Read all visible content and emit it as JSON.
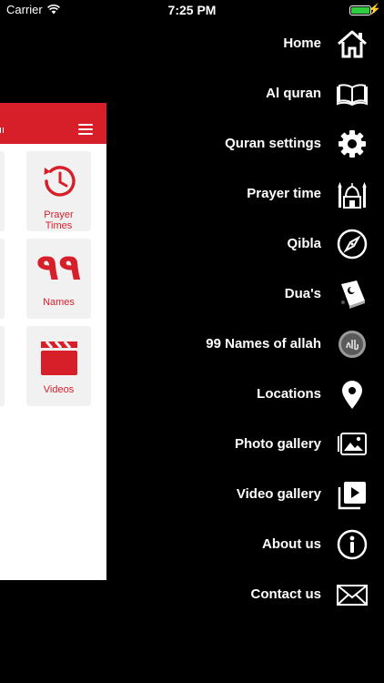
{
  "status_bar": {
    "carrier": "Carrier",
    "time": "7:25 PM",
    "battery_percent": 100,
    "charging": "⚡"
  },
  "panel": {
    "accent": "#d71f2a",
    "tiles": [
      {
        "label": "Prayer\nTimes",
        "icon": "clock-history-icon"
      },
      {
        "label": "Names",
        "icon": "arabic-99-icon",
        "glyph": "٩٩"
      },
      {
        "label": "Videos",
        "icon": "clapperboard-icon"
      }
    ]
  },
  "menu": {
    "items": [
      {
        "label": "Home",
        "icon": "home-icon"
      },
      {
        "label": "Al quran",
        "icon": "open-book-icon"
      },
      {
        "label": "Quran settings",
        "icon": "gear-icon"
      },
      {
        "label": "Prayer time",
        "icon": "mosque-icon"
      },
      {
        "label": "Qibla",
        "icon": "compass-icon"
      },
      {
        "label": "Dua's",
        "icon": "prayer-book-icon"
      },
      {
        "label": "99 Names of allah",
        "icon": "allah-calligraphy-icon"
      },
      {
        "label": "Locations",
        "icon": "location-pin-icon"
      },
      {
        "label": "Photo gallery",
        "icon": "photo-gallery-icon"
      },
      {
        "label": "Video gallery",
        "icon": "video-gallery-icon"
      },
      {
        "label": "About us",
        "icon": "info-icon"
      },
      {
        "label": "Contact us",
        "icon": "envelope-icon"
      }
    ]
  }
}
